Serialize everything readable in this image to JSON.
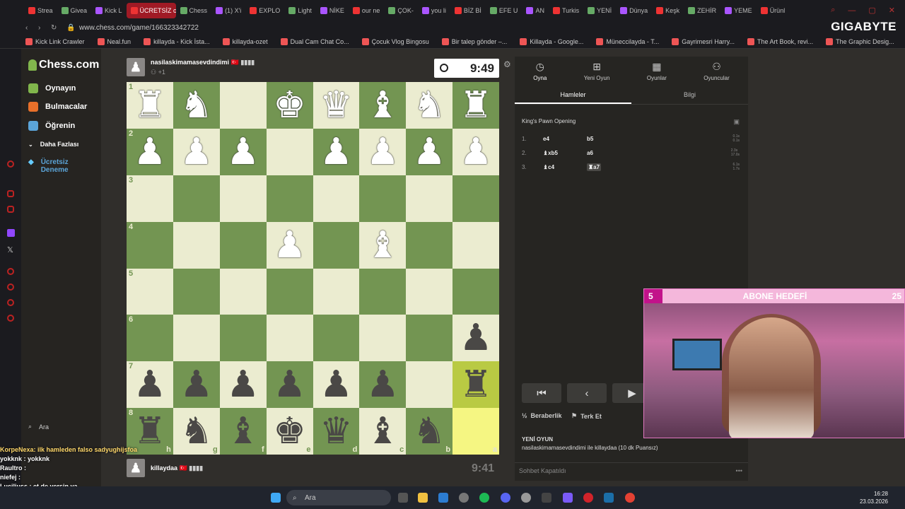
{
  "browser": {
    "tabs": [
      "Strea",
      "Givea",
      "Kick L",
      "ÜCRETSİZ c",
      "Chess",
      "(1) X'i",
      "EXPLO",
      "Light",
      "NİKE",
      "our ne",
      "ÇOK-",
      "you li",
      "BİZ Bİ",
      "EFE U",
      "AN",
      "Turkis",
      "YENİ",
      "Dünya",
      "Keşk",
      "ZEHİR",
      "YEME",
      "Ürünl"
    ],
    "active_tab": 3,
    "url": "www.chess.com/game/166323342722",
    "brand": "GIGABYTE",
    "bookmarks": [
      "Kick Link Crawler",
      "Neal.fun",
      "killayda - Kick İsta...",
      "killayda-ozet",
      "Dual Cam Chat Co...",
      "Çocuk Vlog Bingosu",
      "Bir talep gönder –...",
      "Killayda - Google...",
      "Müneccilayda - T...",
      "Gayrimesri Harry...",
      "The Art Book, revi...",
      "The Graphic Desig..."
    ]
  },
  "sidebar": {
    "logo": "Chess.com",
    "items": [
      {
        "label": "Oynayın",
        "icon": "play-icon",
        "color": "#81b64c"
      },
      {
        "label": "Bulmacalar",
        "icon": "puzzle-icon",
        "color": "#e8702a"
      },
      {
        "label": "Öğrenin",
        "icon": "learn-icon",
        "color": "#5ba4d8"
      }
    ],
    "more": "Daha Fazlası",
    "premium": "Ücretsiz Deneme",
    "search": "Ara"
  },
  "top_player": {
    "name": "nasilaskimamasevdindimi",
    "sub": "+1",
    "flag": "🇹🇷",
    "clock": "9:49"
  },
  "bottom_player": {
    "name": "killaydaa",
    "flag": "🇹🇷",
    "clock": "9:41"
  },
  "board": {
    "ranks": [
      [
        "R",
        "N",
        "",
        "K",
        "Q",
        "B",
        "N",
        "R"
      ],
      [
        "P",
        "P",
        "P",
        "",
        "P",
        "P",
        "P",
        "P"
      ],
      [
        "",
        "",
        "",
        "",
        "",
        "",
        "",
        ""
      ],
      [
        "",
        "",
        "",
        "P",
        "",
        "B",
        "",
        ""
      ],
      [
        "",
        "",
        "",
        "",
        "",
        "",
        "",
        ""
      ],
      [
        "",
        "",
        "",
        "",
        "",
        "",
        "",
        "p"
      ],
      [
        "p",
        "p",
        "p",
        "p",
        "p",
        "p",
        "",
        "r"
      ],
      [
        "r",
        "n",
        "b",
        "k",
        "q",
        "b",
        "n",
        ""
      ]
    ],
    "rank_labels": [
      "1",
      "2",
      "3",
      "4",
      "5",
      "6",
      "7",
      "8"
    ],
    "file_labels": [
      "h",
      "g",
      "f",
      "e",
      "d",
      "c",
      "b",
      "a"
    ]
  },
  "panel": {
    "tabs": [
      {
        "label": "Oyna",
        "icon": "clock-icon"
      },
      {
        "label": "Yeni Oyun",
        "icon": "plus-icon"
      },
      {
        "label": "Oyunlar",
        "icon": "board-icon"
      },
      {
        "label": "Oyuncular",
        "icon": "players-icon"
      }
    ],
    "subtabs": [
      "Hamleler",
      "Bilgi"
    ],
    "opening": "King's Pawn Opening",
    "moves": [
      {
        "n": "1.",
        "w": "e4",
        "b": "b5",
        "t1": "0.1s",
        "t2": "0.1s"
      },
      {
        "n": "2.",
        "w": "♝xb5",
        "b": "a6",
        "t1": "2.3s",
        "t2": "17.0s"
      },
      {
        "n": "3.",
        "w": "♝c4",
        "b": "♜a7",
        "t1": "6.1s",
        "t2": "1.7s"
      }
    ],
    "draw": "Beraberlik",
    "resign": "Terk Et",
    "new_game_title": "YENİ OYUN",
    "new_game_text": "nasilaskimamasevdindimi ile killaydaa (10 dk Puansız)",
    "chat_closed": "Sohbet Kapatıldı"
  },
  "stream": {
    "goal_left": "5",
    "goal_title": "ABONE HEDEFİ",
    "goal_right": "25",
    "chat": [
      "KorpeNexa: ilk hamleden falso sadyughijsfoa",
      "yokknk : yokknk",
      "Raultro :",
      "niefej :",
      "Luciliuss : et de yersin ya"
    ]
  },
  "taskbar": {
    "search": "Ara",
    "time": "16:28",
    "date": "23.03.2026"
  }
}
